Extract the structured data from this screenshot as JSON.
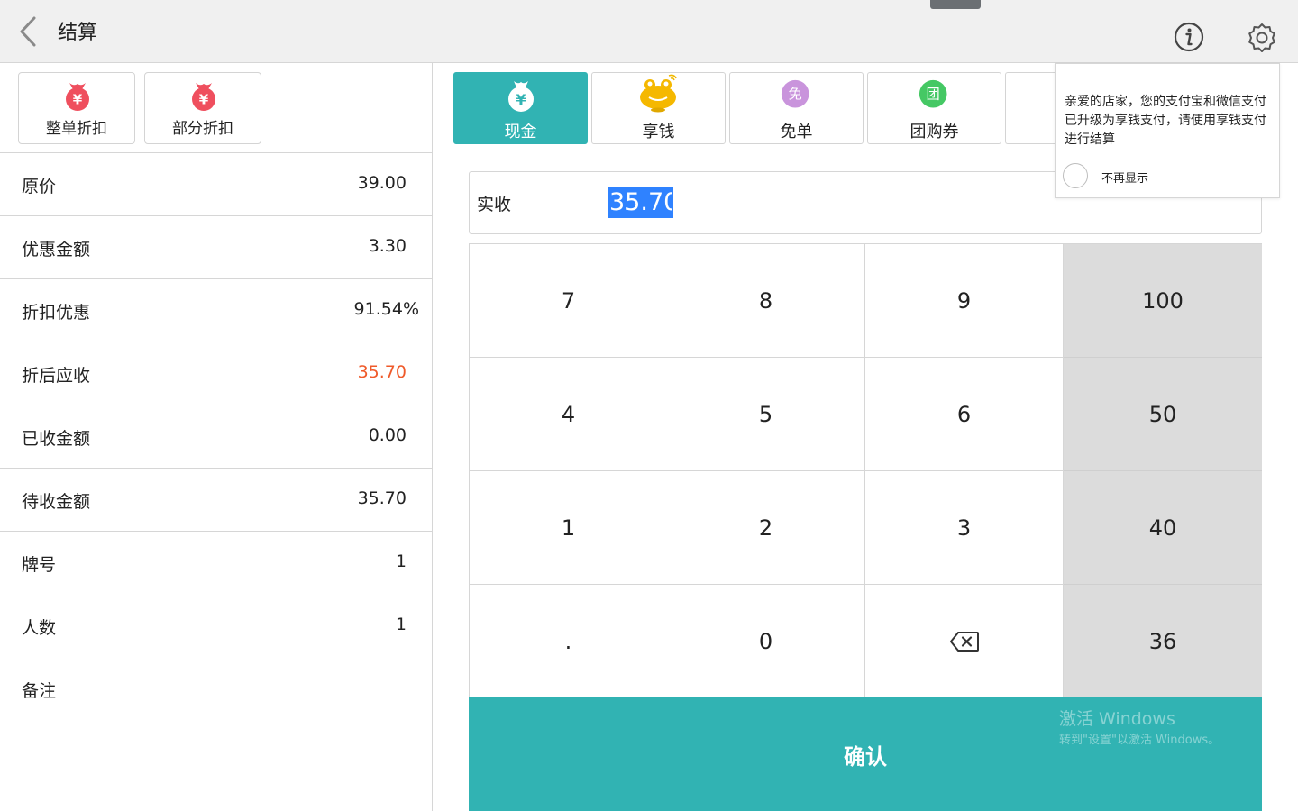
{
  "header": {
    "title": "结算",
    "back_icon": "chevron-left-icon",
    "info_icon": "info-icon",
    "settings_icon": "gear-icon"
  },
  "discounts": [
    {
      "label": "整单折扣",
      "icon": "money-bag-icon"
    },
    {
      "label": "部分折扣",
      "icon": "money-bag-icon"
    }
  ],
  "summary": {
    "original_price": {
      "label": "原价",
      "value": "39.00"
    },
    "discount_amount": {
      "label": "优惠金额",
      "value": "3.30"
    },
    "discount_rate": {
      "label": "折扣优惠",
      "value": "91.54%"
    },
    "payable": {
      "label": "折后应收",
      "value": "35.70"
    },
    "received": {
      "label": "已收金额",
      "value": "0.00"
    },
    "pending": {
      "label": "待收金额",
      "value": "35.70"
    },
    "table_no": {
      "label": "牌号",
      "value": "1"
    },
    "guests": {
      "label": "人数",
      "value": "1"
    },
    "remark": {
      "label": "备注",
      "value": ""
    }
  },
  "payment_tabs": [
    {
      "label": "现金",
      "icon": "cash-bag-icon",
      "active": true
    },
    {
      "label": "享钱",
      "icon": "frog-icon",
      "active": false
    },
    {
      "label": "免单",
      "icon": "free-icon",
      "icon_text": "免",
      "active": false
    },
    {
      "label": "团购券",
      "icon": "group-buy-icon",
      "icon_text": "团",
      "active": false
    }
  ],
  "amount": {
    "label": "实收",
    "value": "35.70"
  },
  "keypad": {
    "keys": [
      "7",
      "8",
      "9",
      "4",
      "5",
      "6",
      "1",
      "2",
      "3",
      ".",
      "0"
    ],
    "backspace_icon": "backspace-icon",
    "quick_amounts": [
      "100",
      "50",
      "40",
      "36"
    ]
  },
  "confirm_label": "确认",
  "popup": {
    "message": "亲爱的店家，您的支付宝和微信支付已升级为享钱支付，请使用享钱支付进行结算",
    "dont_show_label": "不再显示"
  },
  "watermark": {
    "line1": "激活 Windows",
    "line2": "转到\"设置\"以激活 Windows。"
  },
  "colors": {
    "accent": "#31b3b3",
    "highlight_red": "#ef5a2a",
    "selection_blue": "#2f82ff",
    "quick_key_bg": "#dcdcdc"
  }
}
